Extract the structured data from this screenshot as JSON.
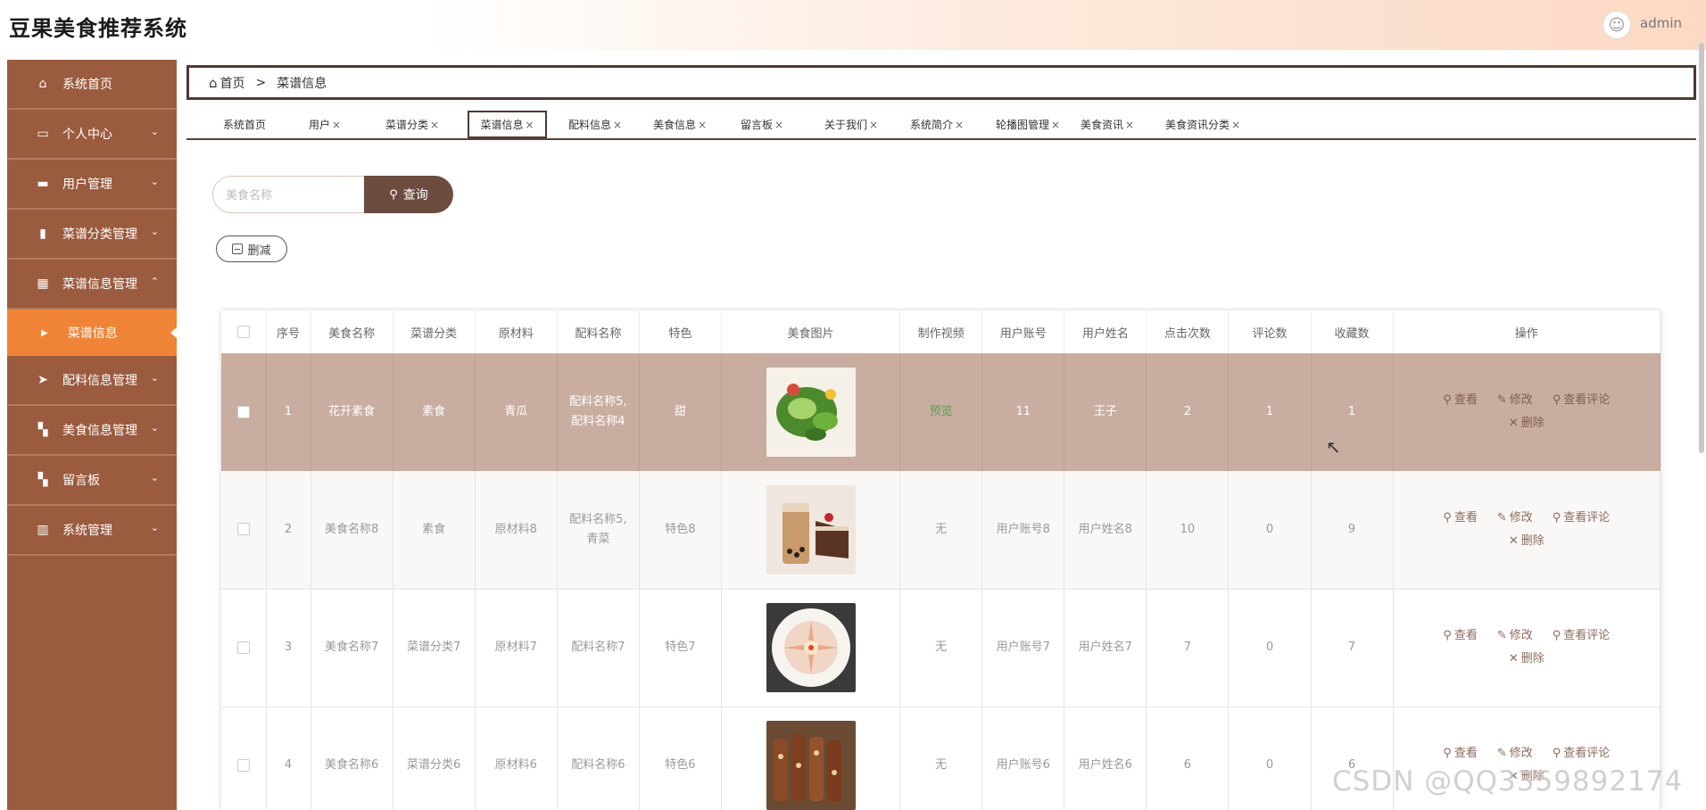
{
  "app": {
    "title": "豆果美食推荐系统",
    "user": "admin"
  },
  "sidebar": {
    "items": [
      {
        "label": "系统首页",
        "icon": "home-icon",
        "glyph": "⌂",
        "chevron": ""
      },
      {
        "label": "个人中心",
        "icon": "id-card-icon",
        "glyph": "▭",
        "chevron": "⌄"
      },
      {
        "label": "用户管理",
        "icon": "briefcase-icon",
        "glyph": "▬",
        "chevron": "⌄"
      },
      {
        "label": "菜谱分类管理",
        "icon": "clipboard-icon",
        "glyph": "▮",
        "chevron": "⌄"
      },
      {
        "label": "菜谱信息管理",
        "icon": "grid-icon",
        "glyph": "▦",
        "chevron": "⌃"
      },
      {
        "label": "配料信息管理",
        "icon": "paper-plane-icon",
        "glyph": "➤",
        "chevron": "⌄"
      },
      {
        "label": "美食信息管理",
        "icon": "apps-icon",
        "glyph": "▚",
        "chevron": "⌄"
      },
      {
        "label": "留言板",
        "icon": "apps-icon",
        "glyph": "▚",
        "chevron": "⌄"
      },
      {
        "label": "系统管理",
        "icon": "bar-chart-icon",
        "glyph": "▥",
        "chevron": "⌄"
      }
    ],
    "active_sub": "菜谱信息"
  },
  "breadcrumb": {
    "home": "首页",
    "separator": ">",
    "current": "菜谱信息"
  },
  "tabs": [
    {
      "label": "系统首页",
      "close": ""
    },
    {
      "label": "用户",
      "close": "×"
    },
    {
      "label": "菜谱分类",
      "close": "×"
    },
    {
      "label": "菜谱信息",
      "close": "×"
    },
    {
      "label": "配料信息",
      "close": "×"
    },
    {
      "label": "美食信息",
      "close": "×"
    },
    {
      "label": "留言板",
      "close": "×"
    },
    {
      "label": "关于我们",
      "close": "×"
    },
    {
      "label": "系统简介",
      "close": "×"
    },
    {
      "label": "轮播图管理",
      "close": "×"
    },
    {
      "label": "美食资讯",
      "close": "×"
    },
    {
      "label": "美食资讯分类",
      "close": "×"
    }
  ],
  "search": {
    "placeholder": "美食名称",
    "button": "查询"
  },
  "batch_delete": "删减",
  "table": {
    "headers": [
      "",
      "序号",
      "美食名称",
      "菜谱分类",
      "原材料",
      "配料名称",
      "特色",
      "美食图片",
      "制作视频",
      "用户账号",
      "用户姓名",
      "点击次数",
      "评论数",
      "收藏数",
      "操作"
    ],
    "rows": [
      {
        "no": "1",
        "name": "花开素食",
        "category": "素食",
        "material": "青瓜",
        "ingredients": "配料名称5,配料名称4",
        "feature": "甜",
        "image": "veggie-roll",
        "video": "预览",
        "account": "11",
        "username": "王子",
        "clicks": "2",
        "comments": "1",
        "favorites": "1"
      },
      {
        "no": "2",
        "name": "美食名称8",
        "category": "素食",
        "material": "原材料8",
        "ingredients": "配料名称5,青菜",
        "feature": "特色8",
        "image": "milk-tea-cake",
        "video": "无",
        "account": "用户账号8",
        "username": "用户姓名8",
        "clicks": "10",
        "comments": "0",
        "favorites": "9"
      },
      {
        "no": "3",
        "name": "美食名称7",
        "category": "菜谱分类7",
        "material": "原材料7",
        "ingredients": "配料名称7",
        "feature": "特色7",
        "image": "sashimi-plate",
        "video": "无",
        "account": "用户账号7",
        "username": "用户姓名7",
        "clicks": "7",
        "comments": "0",
        "favorites": "7"
      },
      {
        "no": "4",
        "name": "美食名称6",
        "category": "菜谱分类6",
        "material": "原材料6",
        "ingredients": "配料名称6",
        "feature": "特色6",
        "image": "bbq-skewers",
        "video": "无",
        "account": "用户账号6",
        "username": "用户姓名6",
        "clicks": "6",
        "comments": "0",
        "favorites": "6"
      }
    ],
    "actions": {
      "view": "查看",
      "edit": "修改",
      "comments": "查看评论",
      "delete": "删除"
    }
  },
  "watermark": "CSDN @QQ3359892174",
  "colors": {
    "sidebar": "#9b5b3e",
    "active": "#f08436",
    "accent": "#6b4c3f",
    "selected_row": "#c9ada0"
  }
}
